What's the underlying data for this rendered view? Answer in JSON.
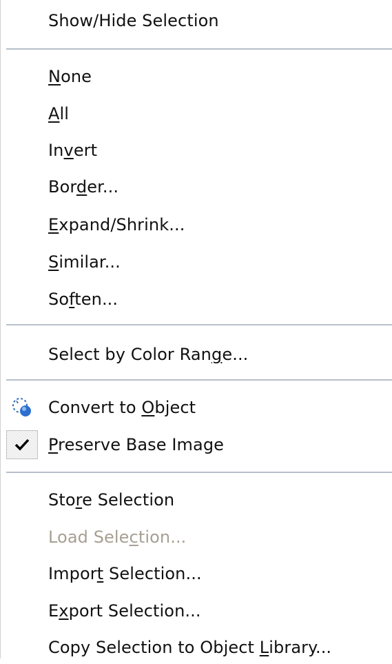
{
  "menu": {
    "items": [
      {
        "id": "show_hide",
        "plain": "Show/Hide Selection"
      },
      {
        "id": "none",
        "pre": "",
        "u": "N",
        "post": "one"
      },
      {
        "id": "all",
        "pre": "",
        "u": "A",
        "post": "ll"
      },
      {
        "id": "invert",
        "pre": "In",
        "u": "v",
        "post": "ert"
      },
      {
        "id": "border",
        "pre": "Bor",
        "u": "d",
        "post": "er..."
      },
      {
        "id": "expand",
        "pre": "",
        "u": "E",
        "post": "xpand/Shrink..."
      },
      {
        "id": "similar",
        "pre": "",
        "u": "S",
        "post": "imilar..."
      },
      {
        "id": "soften",
        "pre": "So",
        "u": "f",
        "post": "ten..."
      },
      {
        "id": "color_range",
        "pre": "Select by Color Ran",
        "u": "g",
        "post": "e..."
      },
      {
        "id": "convert",
        "pre": "Convert to ",
        "u": "O",
        "post": "bject",
        "icon": "convert-selection-icon"
      },
      {
        "id": "preserve",
        "pre": "",
        "u": "P",
        "post": "reserve Base Image",
        "icon": "checkmark-icon",
        "checked": true
      },
      {
        "id": "store",
        "pre": "Sto",
        "u": "r",
        "post": "e Selection"
      },
      {
        "id": "load",
        "pre": "Load Sele",
        "u": "c",
        "post": "tion...",
        "disabled": true
      },
      {
        "id": "import",
        "pre": "Impor",
        "u": "t",
        "post": " Selection..."
      },
      {
        "id": "export",
        "pre": "E",
        "u": "x",
        "post": "port Selection..."
      },
      {
        "id": "copy",
        "pre": "Copy Selection to Object ",
        "u": "L",
        "post": "ibrary..."
      }
    ]
  }
}
